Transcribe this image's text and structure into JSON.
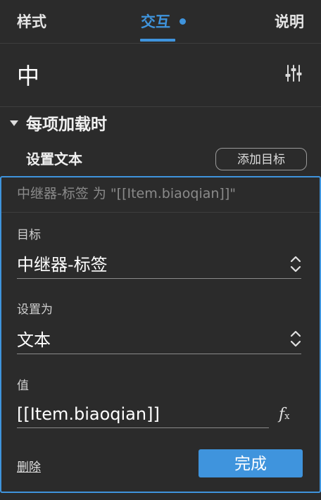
{
  "tabs": {
    "style": "样式",
    "interaction": "交互",
    "description": "说明"
  },
  "widget": {
    "name": "中"
  },
  "event": {
    "title": "每项加载时"
  },
  "action": {
    "title": "设置文本",
    "add_target_label": "添加目标"
  },
  "editor": {
    "summary": "中继器-标签 为 \"[[Item.biaoqian]]\"",
    "target_label": "目标",
    "target_value": "中继器-标签",
    "set_as_label": "设置为",
    "set_as_value": "文本",
    "value_label": "值",
    "value_value": "[[Item.biaoqian]]",
    "fx_main": "f",
    "fx_sub": "x",
    "delete_label": "删除",
    "done_label": "完成"
  },
  "colors": {
    "accent": "#3f94dd",
    "background": "#2b2b2b"
  }
}
